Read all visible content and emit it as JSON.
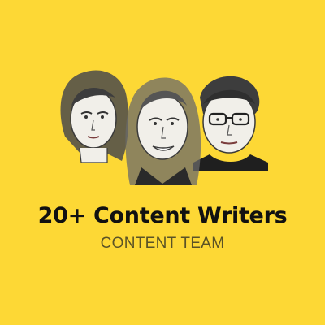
{
  "title": "20+ Content Writers",
  "subtitle": "CONTENT TEAM",
  "colors": {
    "background": "#FDD835",
    "title": "#111111",
    "subtitle": "#5b5326",
    "sketch_line": "#3a3a3a",
    "skin": "#f1efe9"
  },
  "illustration": {
    "people": [
      "woman-left",
      "woman-center",
      "man-right-glasses"
    ]
  }
}
